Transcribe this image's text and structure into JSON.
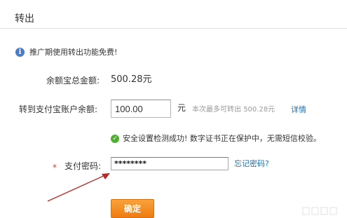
{
  "header": {
    "title": "转出"
  },
  "notice": {
    "icon": "info-icon",
    "text": "推广期使用转出功能免费!"
  },
  "balance": {
    "label": "余额宝总金额:",
    "value": "500.28元"
  },
  "transfer": {
    "label": "转到支付宝账户余额:",
    "amount_value": "100.00",
    "unit": "元",
    "max_prefix": "本次最多可转出",
    "max_amount": "500.28元",
    "details_link": "详情"
  },
  "security": {
    "icon": "check-circle-icon",
    "text": "安全设置检测成功! 数字证书正在保护中，无需短信校验。"
  },
  "password": {
    "required_mark": "*",
    "label": "支付密码:",
    "value": "********",
    "forgot_link": "忘记密码?"
  },
  "confirm_button": {
    "label": "确定"
  },
  "colors": {
    "accent_orange": "#ef7c11",
    "link_blue": "#1a6fb3",
    "success_green": "#4caf2f",
    "required_red": "#e0362c",
    "arrow_red": "#b52a2a"
  }
}
